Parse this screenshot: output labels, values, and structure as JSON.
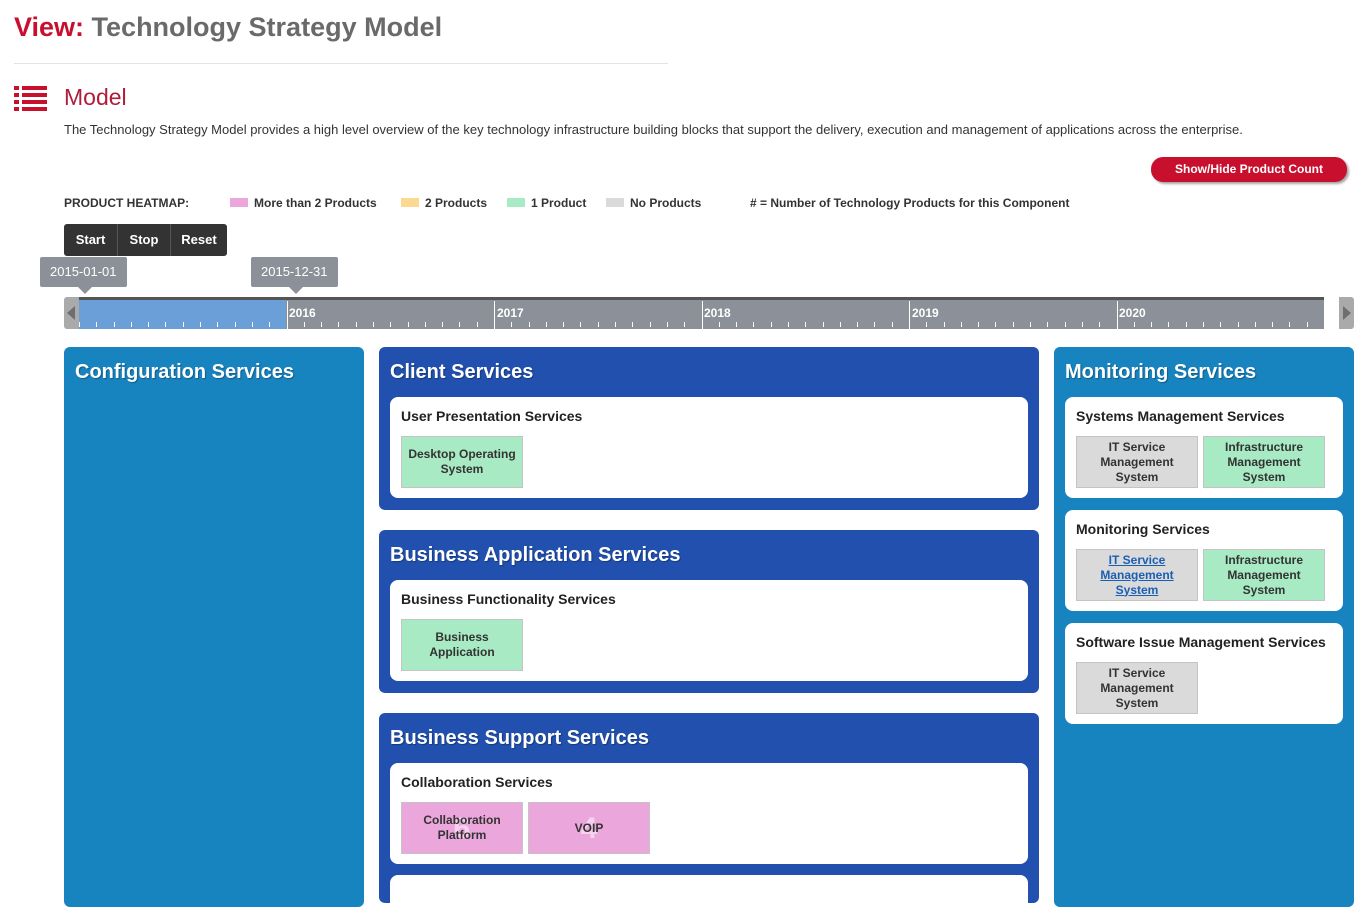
{
  "view": {
    "label": "View:",
    "title": "Technology Strategy Model"
  },
  "section": {
    "title": "Model",
    "icon": "list-icon",
    "description": "The Technology Strategy Model provides a high level overview of the key technology infrastructure building blocks that support the delivery, execution and management of applications across the enterprise."
  },
  "toggle_label": "Show/Hide Product Count",
  "legend": {
    "title": "PRODUCT HEATMAP:",
    "items": [
      {
        "label": "More than 2 Products",
        "color": "#eba6dc"
      },
      {
        "label": "2 Products",
        "color": "#fbd990"
      },
      {
        "label": "1 Product",
        "color": "#a8eac3"
      },
      {
        "label": "No Products",
        "color": "#dadada"
      }
    ],
    "note": "# = Number of Technology Products for this Component"
  },
  "playback": {
    "start": "Start",
    "stop": "Stop",
    "reset": "Reset"
  },
  "timeline": {
    "range_start": "2015-01-01",
    "range_end": "2015-12-31",
    "years": [
      "2016",
      "2017",
      "2018",
      "2019",
      "2020"
    ]
  },
  "colors": {
    "left_col": "#1783bf",
    "mid_col": "#2150ae",
    "right_col": "#1783bf",
    "more_than_2": "#eba6dc",
    "one": "#a8eac3",
    "none": "#dadada"
  },
  "columns": {
    "left": {
      "title": "Configuration Services"
    },
    "middle": [
      {
        "title": "Client Services",
        "groups": [
          {
            "title": "User Presentation Services",
            "tiles": [
              {
                "label": "Desktop Operating System",
                "status": "one",
                "count": ""
              }
            ]
          }
        ]
      },
      {
        "title": "Business Application Services",
        "groups": [
          {
            "title": "Business Functionality Services",
            "tiles": [
              {
                "label": "Business Application",
                "status": "one",
                "count": ""
              }
            ]
          }
        ]
      },
      {
        "title": "Business Support Services",
        "groups": [
          {
            "title": "Collaboration Services",
            "tiles": [
              {
                "label": "Collaboration Platform",
                "status": "more_than_2",
                "count": "6"
              },
              {
                "label": "VOIP",
                "status": "more_than_2",
                "count": "4"
              }
            ]
          }
        ]
      }
    ],
    "right": {
      "title": "Monitoring Services",
      "groups": [
        {
          "title": "Systems Management Services",
          "tiles": [
            {
              "label": "IT Service Management System",
              "status": "none",
              "count": ""
            },
            {
              "label": "Infrastructure Management System",
              "status": "one",
              "count": ""
            }
          ]
        },
        {
          "title": "Monitoring Services",
          "tiles": [
            {
              "label": "IT Service Management System",
              "status": "none",
              "count": "",
              "link": true
            },
            {
              "label": "Infrastructure Management System",
              "status": "one",
              "count": ""
            }
          ]
        },
        {
          "title": "Software Issue Management Services",
          "tiles": [
            {
              "label": "IT Service Management System",
              "status": "none",
              "count": ""
            }
          ]
        }
      ]
    }
  }
}
